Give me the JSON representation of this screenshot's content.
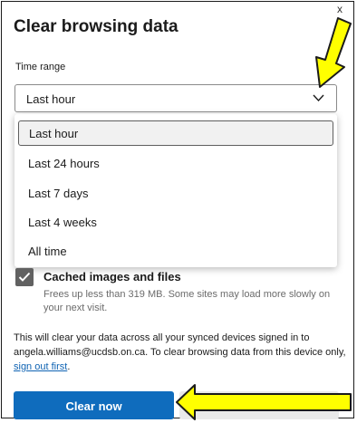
{
  "dialog": {
    "title": "Clear browsing data",
    "close_glyph": "x"
  },
  "time_range": {
    "label": "Time range",
    "selected": "Last hour",
    "options": [
      "Last hour",
      "Last 24 hours",
      "Last 7 days",
      "Last 4 weeks",
      "All time"
    ]
  },
  "cached": {
    "checked": true,
    "label": "Cached images and files",
    "description": "Frees up less than 319 MB. Some sites may load more slowly on your next visit."
  },
  "sync_note": {
    "text": "This will clear your data across all your synced devices signed in to angela.williams@ucdsb.on.ca. To clear browsing data from this device only, ",
    "link": "sign out first",
    "end": "."
  },
  "buttons": {
    "clear": "Clear now"
  },
  "colors": {
    "accent": "#0f6cbd",
    "annotation_arrow": "#ffff00"
  },
  "icons": {
    "dropdown": "chevron-down-icon",
    "checkbox": "checkmark-icon",
    "annotations": "yellow-arrow-icon"
  }
}
